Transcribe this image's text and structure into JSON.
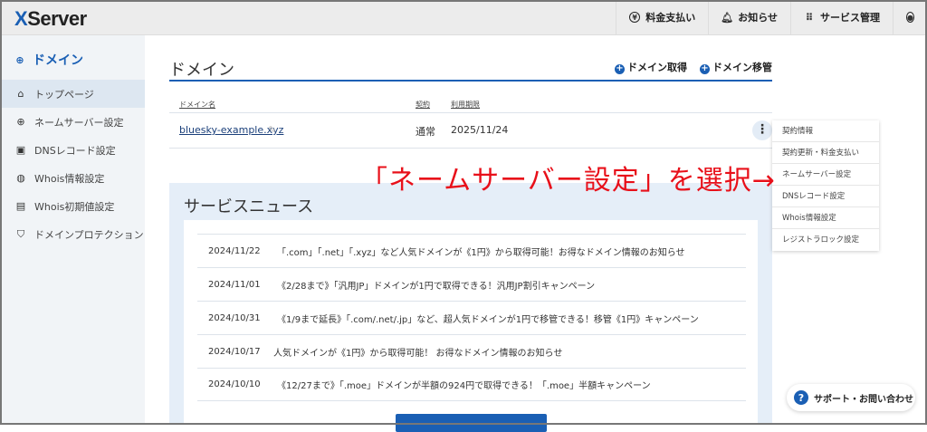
{
  "header": {
    "logo": "XServer",
    "nav": [
      {
        "icon": "yen-icon",
        "label": "料金支払い"
      },
      {
        "icon": "bell-icon",
        "label": "お知らせ"
      },
      {
        "icon": "grid-icon",
        "label": "サービス管理"
      }
    ]
  },
  "sidebar": {
    "title": "ドメイン",
    "items": [
      {
        "label": "トップページ",
        "icon": "home-icon"
      },
      {
        "label": "ネームサーバー設定",
        "icon": "globe-icon"
      },
      {
        "label": "DNSレコード設定",
        "icon": "server-icon"
      },
      {
        "label": "Whois情報設定",
        "icon": "whois-icon"
      },
      {
        "label": "Whois初期値設定",
        "icon": "document-icon"
      },
      {
        "label": "ドメインプロテクション",
        "icon": "shield-icon"
      }
    ]
  },
  "main": {
    "title": "ドメイン",
    "actions": [
      "ドメイン取得",
      "ドメイン移管"
    ],
    "table": {
      "headers": [
        "ドメイン名",
        "契約",
        "利用期限"
      ],
      "rows": [
        {
          "domain": "bluesky-example.xyz",
          "contract": "通常",
          "expiry": "2025/11/24"
        }
      ]
    },
    "menu": [
      "契約情報",
      "契約更新・料金支払い",
      "ネームサーバー設定",
      "DNSレコード設定",
      "Whois情報設定",
      "レジストラロック設定"
    ]
  },
  "annotation": "「ネームサーバー設定」を選択→",
  "news": {
    "title": "サービスニュース",
    "items": [
      {
        "date": "2024/11/22",
        "text": "「.com」「.net」「.xyz」など人気ドメインが《1円》から取得可能！お得なドメイン情報のお知らせ"
      },
      {
        "date": "2024/11/01",
        "text": "《2/28まで》「汎用JP」ドメインが1円で取得できる！汎用JP割引キャンペーン"
      },
      {
        "date": "2024/10/31",
        "text": "《1/9まで延長》「.com/.net/.jp」など、超人気ドメインが1円で移管できる！移管《1円》キャンペーン"
      },
      {
        "date": "2024/10/17",
        "text": "人気ドメインが《1円》から取得可能！ お得なドメイン情報のお知らせ"
      },
      {
        "date": "2024/10/10",
        "text": "《12/27まで》「.moe」ドメインが半額の924円で取得できる！「.moe」半額キャンペーン"
      }
    ]
  },
  "support": "サポート・お問い合わせ",
  "colors": {
    "accent": "#1a5fb4",
    "annotation": "#e8101a"
  }
}
